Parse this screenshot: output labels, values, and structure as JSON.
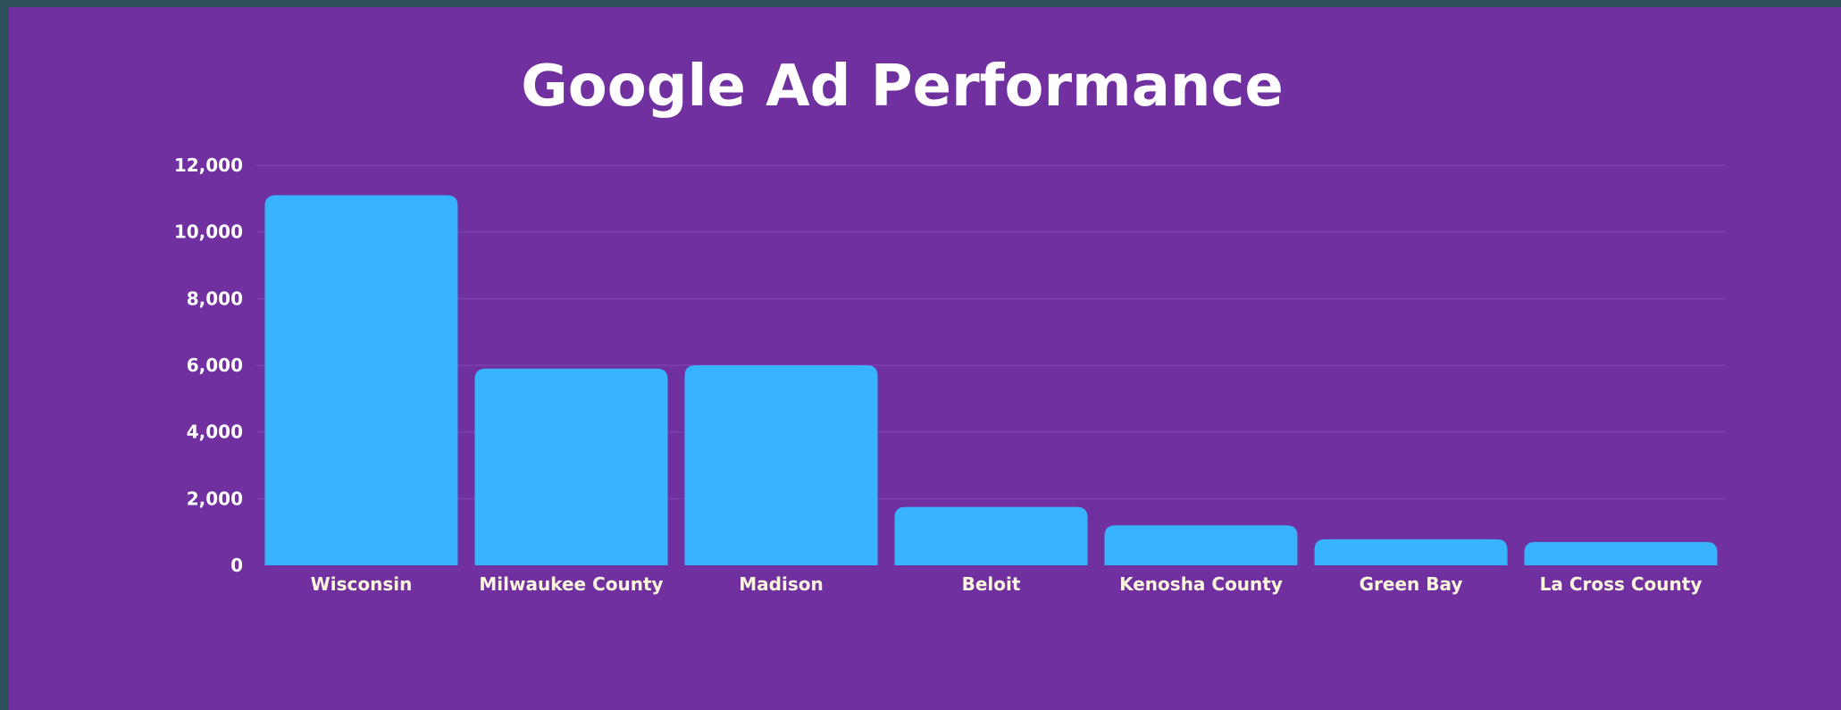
{
  "chart_data": {
    "type": "bar",
    "title": "Google Ad Performance",
    "xlabel": "",
    "ylabel": "",
    "categories": [
      "Wisconsin",
      "Milwaukee County",
      "Madison",
      "Beloit",
      "Kenosha County",
      "Green Bay",
      "La Cross County"
    ],
    "values": [
      11100,
      5900,
      6000,
      1750,
      1200,
      780,
      700
    ],
    "ylim": [
      0,
      12000
    ],
    "yticks": [
      0,
      2000,
      4000,
      6000,
      8000,
      10000,
      12000
    ],
    "ytick_labels": [
      "0",
      "2,000",
      "4,000",
      "6,000",
      "8,000",
      "10,000",
      "12,000"
    ],
    "grid": true,
    "legend": "none",
    "colors": {
      "background": "#7030a0",
      "bar": "#38b4ff",
      "grid": "#7d3fb0",
      "text": "#ffffff"
    }
  }
}
